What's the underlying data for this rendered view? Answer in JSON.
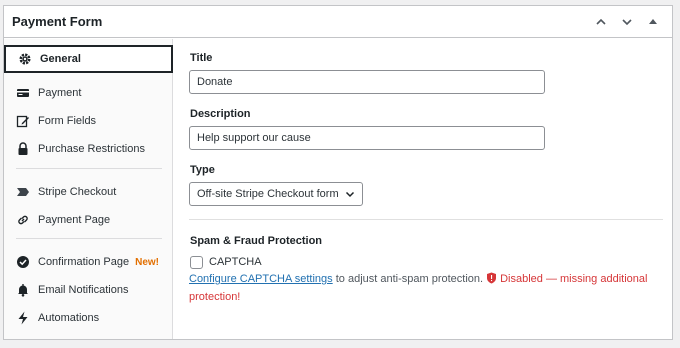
{
  "header": {
    "title": "Payment Form",
    "controls": [
      "chevron-up-icon",
      "chevron-down-icon",
      "triangle-up-icon"
    ]
  },
  "sidebar": {
    "items": [
      {
        "label": "General",
        "icon": "gear-icon",
        "active": true
      },
      {
        "label": "Payment",
        "icon": "credit-card-icon"
      },
      {
        "label": "Form Fields",
        "icon": "edit-icon"
      },
      {
        "label": "Purchase Restrictions",
        "icon": "lock-icon"
      },
      {
        "label": "Stripe Checkout",
        "icon": "stripe-icon"
      },
      {
        "label": "Payment Page",
        "icon": "link-icon"
      },
      {
        "label": "Confirmation Page",
        "icon": "check-circle-icon",
        "badge": "New!"
      },
      {
        "label": "Email Notifications",
        "icon": "bell-icon"
      },
      {
        "label": "Automations",
        "icon": "bolt-icon"
      }
    ]
  },
  "main": {
    "title_label": "Title",
    "title_value": "Donate",
    "description_label": "Description",
    "description_value": "Help support our cause",
    "type_label": "Type",
    "type_value": "Off-site Stripe Checkout form",
    "spam_heading": "Spam & Fraud Protection",
    "captcha_label": "CAPTCHA",
    "captcha_link": "Configure CAPTCHA settings",
    "captcha_help": " to adjust anti-spam protection.",
    "captcha_status": "Disabled — missing additional protection!"
  },
  "colors": {
    "accent": "#2271b1",
    "error": "#d63638",
    "badge": "#e26f00"
  }
}
